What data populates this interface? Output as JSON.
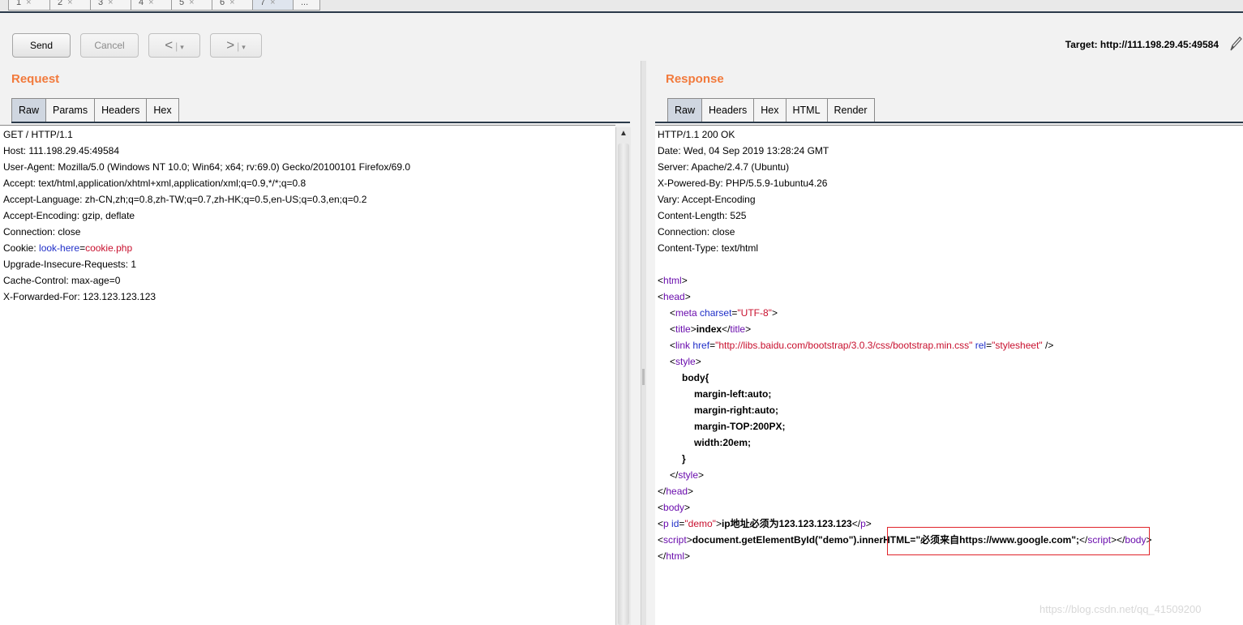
{
  "tabs": [
    {
      "label": "1",
      "close": "×"
    },
    {
      "label": "2",
      "close": "×"
    },
    {
      "label": "3",
      "close": "×"
    },
    {
      "label": "4",
      "close": "×"
    },
    {
      "label": "5",
      "close": "×"
    },
    {
      "label": "6",
      "close": "×"
    },
    {
      "label": "7",
      "close": "×"
    },
    {
      "label": "..."
    }
  ],
  "toolbar": {
    "send_label": "Send",
    "cancel_label": "Cancel",
    "back_arrow": "<",
    "forward_arrow": ">",
    "dropdown": "▾",
    "target_text": "Target: http://111.198.29.45:49584",
    "edit_icon": "pencil-icon"
  },
  "request": {
    "title": "Request",
    "tabs": [
      "Raw",
      "Params",
      "Headers",
      "Hex"
    ],
    "lines": [
      "GET / HTTP/1.1",
      "Host: 111.198.29.45:49584",
      "User-Agent: Mozilla/5.0 (Windows NT 10.0; Win64; x64; rv:69.0) Gecko/20100101 Firefox/69.0",
      "Accept: text/html,application/xhtml+xml,application/xml;q=0.9,*/*;q=0.8",
      "Accept-Language: zh-CN,zh;q=0.8,zh-TW;q=0.7,zh-HK;q=0.5,en-US;q=0.3,en;q=0.2",
      "Accept-Encoding: gzip, deflate",
      "Connection: close"
    ],
    "cookie": {
      "prefix": "Cookie: ",
      "name": "look-here",
      "eq": "=",
      "value": "cookie.php"
    },
    "lines_after": [
      "Upgrade-Insecure-Requests: 1",
      "Cache-Control: max-age=0",
      "X-Forwarded-For: 123.123.123.123"
    ]
  },
  "response": {
    "title": "Response",
    "tabs": [
      "Raw",
      "Headers",
      "Hex",
      "HTML",
      "Render"
    ],
    "headers": [
      "HTTP/1.1 200 OK",
      "Date: Wed, 04 Sep 2019 13:28:24 GMT",
      "Server: Apache/2.4.7 (Ubuntu)",
      "X-Powered-By: PHP/5.5.9-1ubuntu4.26",
      "Vary: Accept-Encoding",
      "Content-Length: 525",
      "Connection: close",
      "Content-Type: text/html"
    ],
    "html": {
      "bom": "",
      "t_html": "html",
      "t_head": "head",
      "t_meta": "meta",
      "a_charset": "charset",
      "v_charset": "\"UTF-8\"",
      "t_title": "title",
      "title_text": "index",
      "t_link": "link",
      "a_href": "href",
      "v_href": "\"http://libs.baidu.com/bootstrap/3.0.3/css/bootstrap.min.css\"",
      "a_rel": "rel",
      "v_rel": "\"stylesheet\"",
      "t_style": "style",
      "css_lines": [
        "body{",
        "margin-left:auto;",
        "margin-right:auto;",
        "margin-TOP:200PX;",
        "width:20em;",
        "}"
      ],
      "t_body": "body",
      "t_p": "p",
      "a_id": "id",
      "v_id": "\"demo\"",
      "p_text": "ip地址必须为123.123.123.123",
      "t_script": "script",
      "script_part1": "document.getElementById(\"demo\")",
      "script_part2": ".innerHTML=\"必须来自https://www.google.com\";"
    }
  },
  "watermark": "https://blog.csdn.net/qq_41509200"
}
